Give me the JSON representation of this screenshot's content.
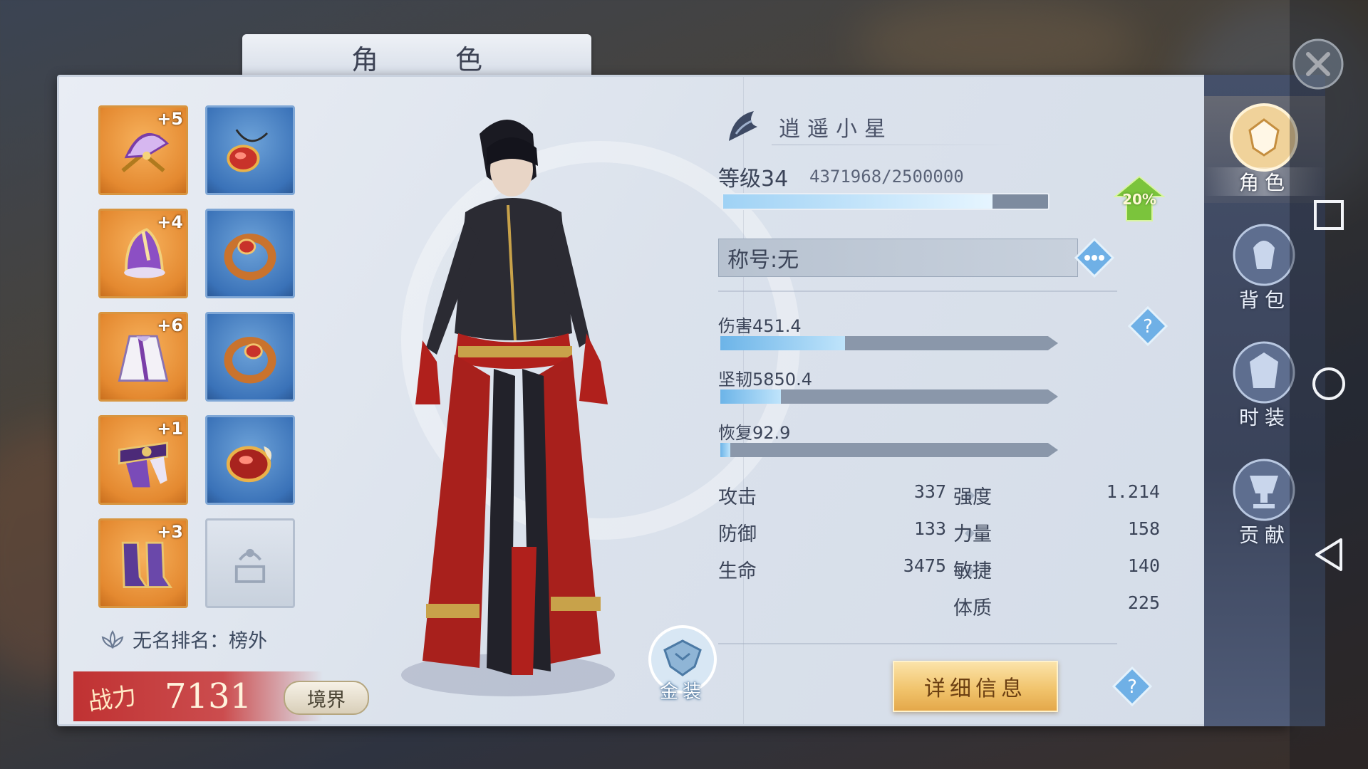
{
  "window": {
    "title": "角 色"
  },
  "equipment": {
    "left_column": [
      {
        "name": "fan",
        "plus": "+5"
      },
      {
        "name": "helmet",
        "plus": "+4"
      },
      {
        "name": "robe",
        "plus": "+6"
      },
      {
        "name": "belt",
        "plus": "+1"
      },
      {
        "name": "boots",
        "plus": "+3"
      }
    ],
    "right_column": [
      {
        "name": "necklace"
      },
      {
        "name": "ring"
      },
      {
        "name": "ring"
      },
      {
        "name": "amulet"
      },
      {
        "name": "empty-slot"
      }
    ]
  },
  "rank": {
    "label": "无名排名：榜外"
  },
  "power": {
    "label": "战力",
    "value": "7131"
  },
  "realm_button": "境界",
  "gold_outfit_button": "金装",
  "character": {
    "name": "逍遥小星",
    "level_label": "等级34",
    "exp_text": "4371968/2500000",
    "exp_fraction": 0.83,
    "level_badge": "20%",
    "title_text": "称号:无"
  },
  "bars": [
    {
      "label": "伤害451.4",
      "fraction": 0.37
    },
    {
      "label": "坚韧5850.4",
      "fraction": 0.18
    },
    {
      "label": "恢复92.9",
      "fraction": 0.03
    }
  ],
  "attributes_left": [
    {
      "label": "攻击",
      "value": "337"
    },
    {
      "label": "防御",
      "value": "133"
    },
    {
      "label": "生命",
      "value": "3475"
    }
  ],
  "attributes_right": [
    {
      "label": "强度",
      "value": "1.214"
    },
    {
      "label": "力量",
      "value": "158"
    },
    {
      "label": "敏捷",
      "value": "140"
    },
    {
      "label": "体质",
      "value": "225"
    }
  ],
  "detail_button": "详细信息",
  "side_tabs": [
    {
      "label": "角色",
      "icon": "character-tab-icon",
      "active": true
    },
    {
      "label": "背包",
      "icon": "bag-tab-icon",
      "active": false
    },
    {
      "label": "时装",
      "icon": "fashion-tab-icon",
      "active": false
    },
    {
      "label": "贡献",
      "icon": "contribution-tab-icon",
      "active": false
    }
  ],
  "colors": {
    "accent_gold": "#f1c46d",
    "slot_orange": "#e48930",
    "slot_blue": "#3a72b8",
    "power_red": "#c83232"
  }
}
